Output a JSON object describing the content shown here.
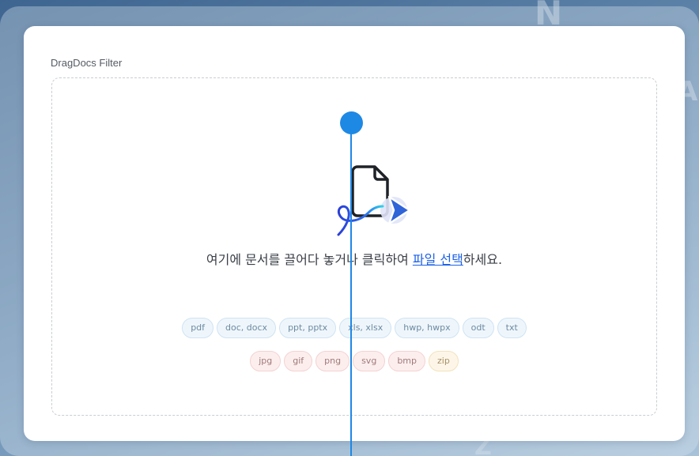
{
  "background": {
    "letters": [
      "N",
      "A",
      "Z"
    ]
  },
  "card": {
    "title": "DragDocs Filter"
  },
  "dropzone": {
    "text_before": "여기에 문서를 끌어다 놓거나 클릭하여 ",
    "link_text": "파일 선택",
    "text_after": "하세요.",
    "illustration": "document-drop-icon",
    "accent_color": "#1e62e6"
  },
  "formats": {
    "row1": [
      "pdf",
      "doc, docx",
      "ppt, pptx",
      "xls, xlsx",
      "hwp, hwpx",
      "odt",
      "txt"
    ],
    "row2": [
      "jpg",
      "gif",
      "png",
      "svg",
      "bmp",
      "zip"
    ]
  },
  "colors": {
    "guide": "#1e88e5",
    "chip_blue": "#eef6fc",
    "chip_red": "#fdeeee",
    "chip_amber": "#fdf6e8"
  }
}
